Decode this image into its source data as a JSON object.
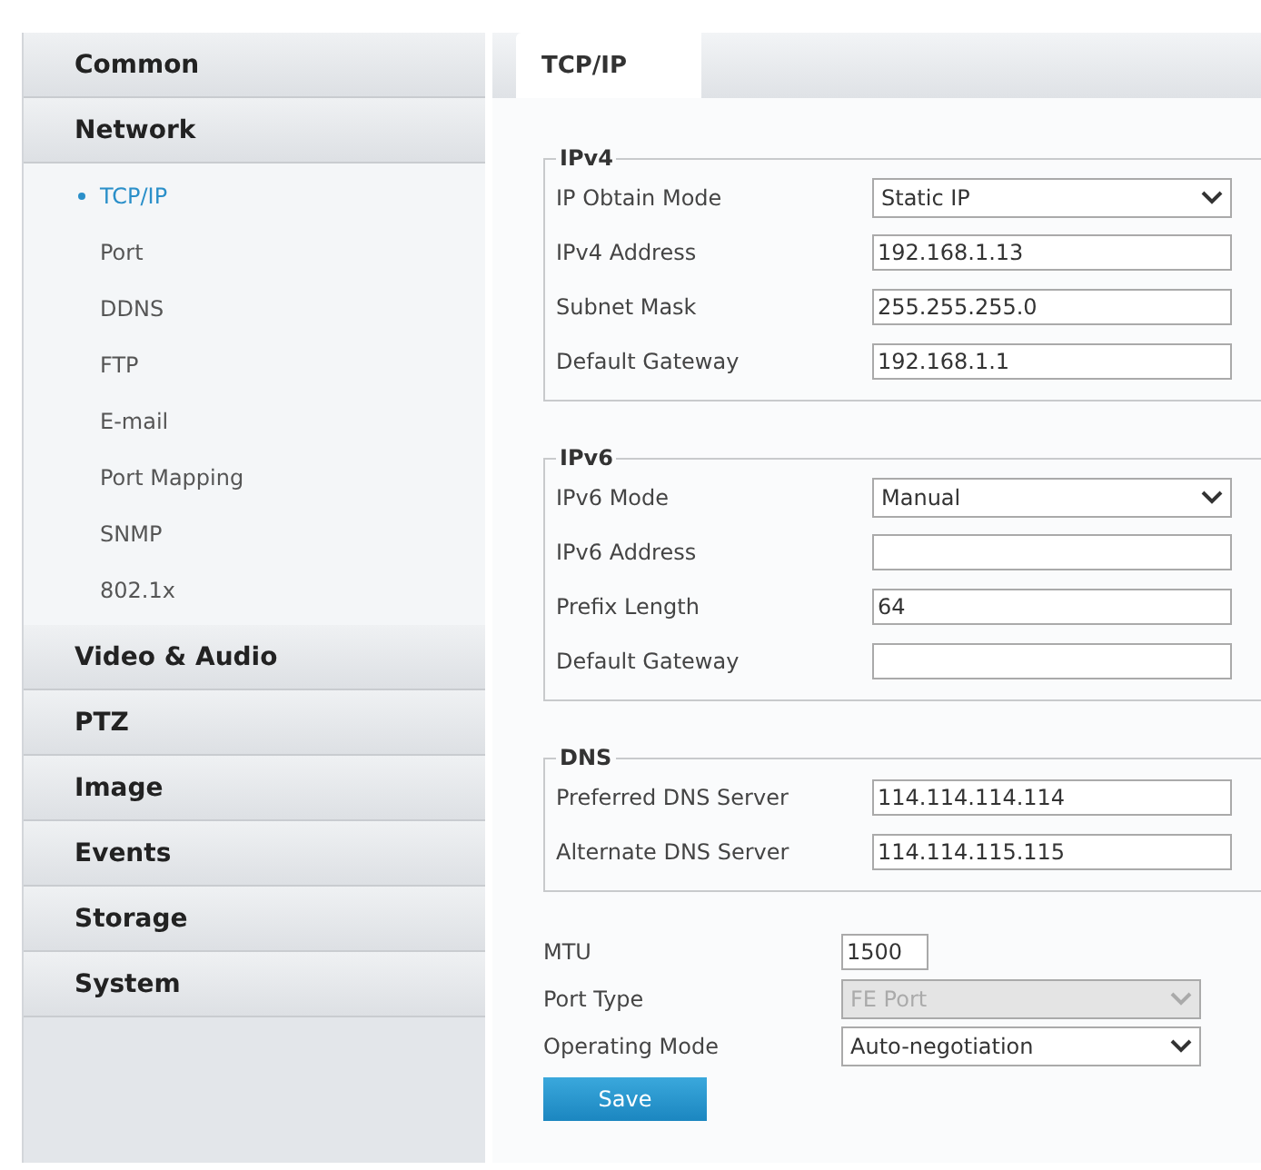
{
  "sidebar": {
    "sections": [
      {
        "label": "Common"
      },
      {
        "label": "Network",
        "items": [
          {
            "label": "TCP/IP",
            "selected": true
          },
          {
            "label": "Port",
            "selected": false
          },
          {
            "label": "DDNS",
            "selected": false
          },
          {
            "label": "FTP",
            "selected": false
          },
          {
            "label": "E-mail",
            "selected": false
          },
          {
            "label": "Port Mapping",
            "selected": false
          },
          {
            "label": "SNMP",
            "selected": false
          },
          {
            "label": "802.1x",
            "selected": false
          }
        ]
      },
      {
        "label": "Video & Audio"
      },
      {
        "label": "PTZ"
      },
      {
        "label": "Image"
      },
      {
        "label": "Events"
      },
      {
        "label": "Storage"
      },
      {
        "label": "System"
      }
    ]
  },
  "tabs": [
    {
      "label": "TCP/IP",
      "selected": true
    }
  ],
  "groups": [
    {
      "title": "IPv4",
      "fields": [
        {
          "kind": "select",
          "label": "IP Obtain Mode",
          "value": "Static IP",
          "disabled": false
        },
        {
          "kind": "text",
          "label": "IPv4 Address",
          "value": "192.168.1.13"
        },
        {
          "kind": "text",
          "label": "Subnet Mask",
          "value": "255.255.255.0"
        },
        {
          "kind": "text",
          "label": "Default Gateway",
          "value": "192.168.1.1"
        }
      ]
    },
    {
      "title": "IPv6",
      "fields": [
        {
          "kind": "select",
          "label": "IPv6 Mode",
          "value": "Manual",
          "disabled": false
        },
        {
          "kind": "text",
          "label": "IPv6 Address"
        },
        {
          "kind": "text",
          "label": "Prefix Length",
          "value": "64"
        },
        {
          "kind": "text",
          "label": "Default Gateway"
        }
      ]
    },
    {
      "title": "DNS",
      "fields": [
        {
          "kind": "text",
          "label": "Preferred DNS Server",
          "value": "114.114.114.114"
        },
        {
          "kind": "text",
          "label": "Alternate DNS Server",
          "value": "114.114.115.115"
        }
      ]
    }
  ],
  "extra_fields": [
    {
      "kind": "short",
      "label": "MTU",
      "value": "1500"
    },
    {
      "kind": "select",
      "label": "Port Type",
      "value": "FE Port",
      "disabled": true
    },
    {
      "kind": "select",
      "label": "Operating Mode",
      "value": "Auto-negotiation",
      "disabled": false
    }
  ],
  "save_button": "Save"
}
